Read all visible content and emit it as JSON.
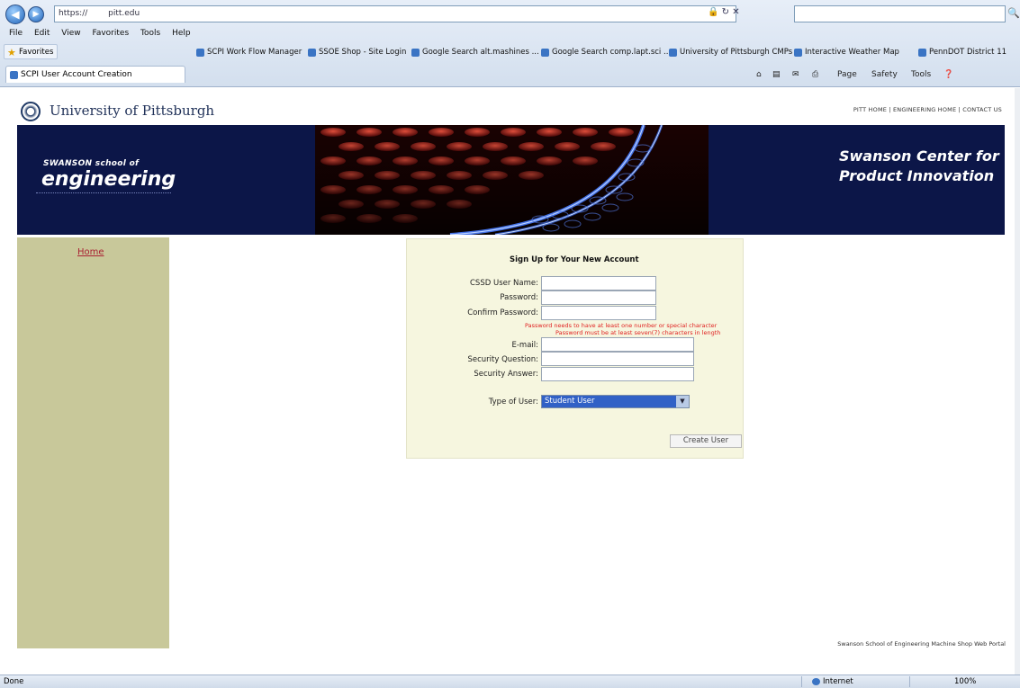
{
  "browser": {
    "address": "https://",
    "address_host": "pitt.edu",
    "search_placeholder": "",
    "menu": [
      "File",
      "Edit",
      "View",
      "Favorites",
      "Tools",
      "Help"
    ],
    "favorites_label": "Favorites",
    "favorites_links": [
      "SCPI Work Flow Manager",
      "SSOE Shop - Site Login",
      "Google Search alt.mashines ...",
      "Google Search comp.lapt.sci ...",
      "University of Pittsburgh CMPs",
      "Interactive Weather Map",
      "PennDOT District 11"
    ],
    "tab_title": "SCPI User Account Creation",
    "commands": [
      "Page",
      "Safety",
      "Tools"
    ],
    "status_text": "Done",
    "zone_text": "Internet",
    "zoom_text": "100%"
  },
  "header": {
    "university": "University of Pittsburgh",
    "top_links": "PITT HOME | ENGINEERING HOME | CONTACT US"
  },
  "banner": {
    "school_small": "SWANSON school of",
    "school_big": "engineering",
    "center_title": "Swanson Center for Product Innovation"
  },
  "sidebar": {
    "home_link": "Home"
  },
  "form": {
    "title": "Sign Up for Your New Account",
    "username_label": "CSSD User Name:",
    "password_label": "Password:",
    "confirm_label": "Confirm Password:",
    "warning_1": "Password needs to have at least one number or special character",
    "warning_2": "Password must be at least seven(7) characters in length",
    "email_label": "E-mail:",
    "question_label": "Security Question:",
    "answer_label": "Security Answer:",
    "user_type_label": "Type of User:",
    "user_type_value": "Student User",
    "create_button": "Create User"
  },
  "footer": {
    "note": "Swanson School of Engineering Machine Shop Web Portal"
  }
}
